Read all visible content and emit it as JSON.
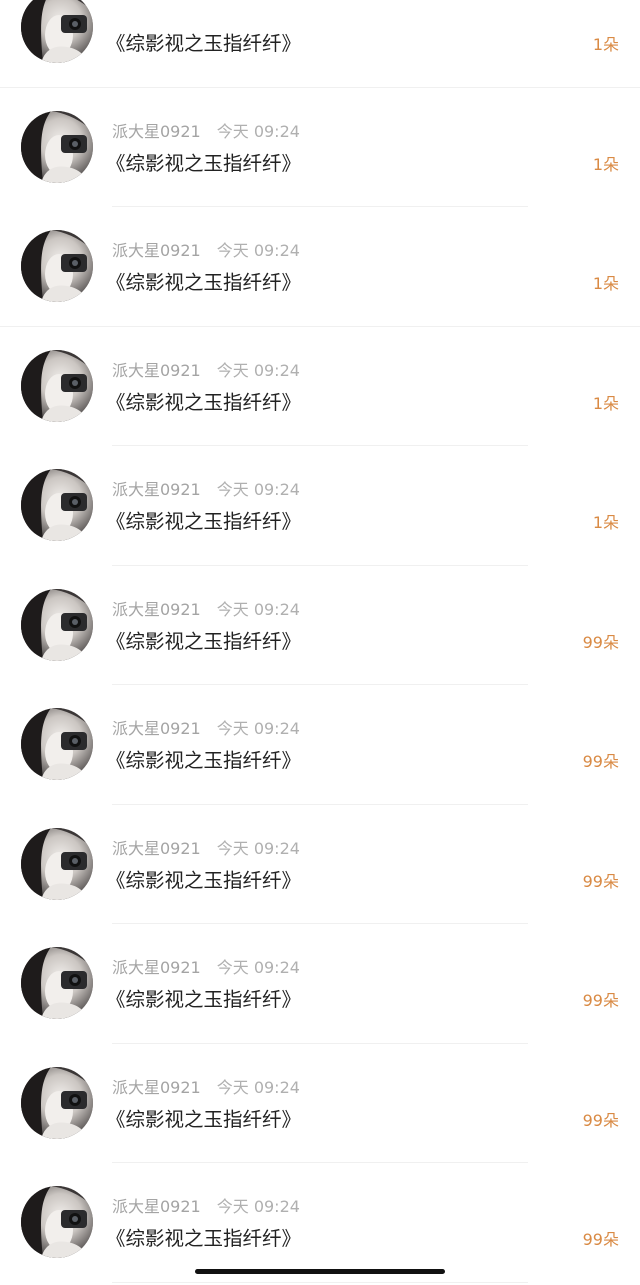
{
  "accent_color": "#d98a44",
  "avatar_icon": "avatar-girl-camera",
  "gifts": [
    {
      "user": "",
      "time": "",
      "title": "《综影视之玉指纤纤》",
      "count": "1朵"
    },
    {
      "user": "派大星0921",
      "time": "今天 09:24",
      "title": "《综影视之玉指纤纤》",
      "count": "1朵"
    },
    {
      "user": "派大星0921",
      "time": "今天 09:24",
      "title": "《综影视之玉指纤纤》",
      "count": "1朵"
    },
    {
      "user": "派大星0921",
      "time": "今天 09:24",
      "title": "《综影视之玉指纤纤》",
      "count": "1朵"
    },
    {
      "user": "派大星0921",
      "time": "今天 09:24",
      "title": "《综影视之玉指纤纤》",
      "count": "1朵"
    },
    {
      "user": "派大星0921",
      "time": "今天 09:24",
      "title": "《综影视之玉指纤纤》",
      "count": "99朵"
    },
    {
      "user": "派大星0921",
      "time": "今天 09:24",
      "title": "《综影视之玉指纤纤》",
      "count": "99朵"
    },
    {
      "user": "派大星0921",
      "time": "今天 09:24",
      "title": "《综影视之玉指纤纤》",
      "count": "99朵"
    },
    {
      "user": "派大星0921",
      "time": "今天 09:24",
      "title": "《综影视之玉指纤纤》",
      "count": "99朵"
    },
    {
      "user": "派大星0921",
      "time": "今天 09:24",
      "title": "《综影视之玉指纤纤》",
      "count": "99朵"
    },
    {
      "user": "派大星0921",
      "time": "今天 09:24",
      "title": "《综影视之玉指纤纤》",
      "count": "99朵"
    }
  ]
}
